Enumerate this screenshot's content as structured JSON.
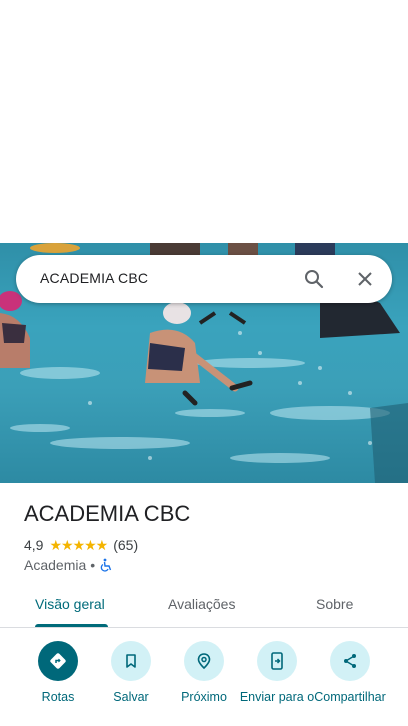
{
  "search": {
    "query": "ACADEMIA CBC"
  },
  "place": {
    "title": "ACADEMIA CBC",
    "rating": "4,9",
    "stars": "★★★★★",
    "review_count": "(65)",
    "category": "Academia",
    "separator": "•"
  },
  "tabs": [
    "Visão geral",
    "Avaliações",
    "Sobre"
  ],
  "actions": [
    {
      "label": "Rotas",
      "icon": "directions-icon"
    },
    {
      "label": "Salvar",
      "icon": "bookmark-icon"
    },
    {
      "label": "Próximo",
      "icon": "nearby-icon"
    },
    {
      "label": "Enviar para o",
      "icon": "send-to-phone-icon"
    },
    {
      "label": "Compartilhar",
      "icon": "share-icon"
    }
  ],
  "colors": {
    "accent": "#00687a",
    "star": "#f4b400",
    "chip": "#d2f1f6"
  }
}
